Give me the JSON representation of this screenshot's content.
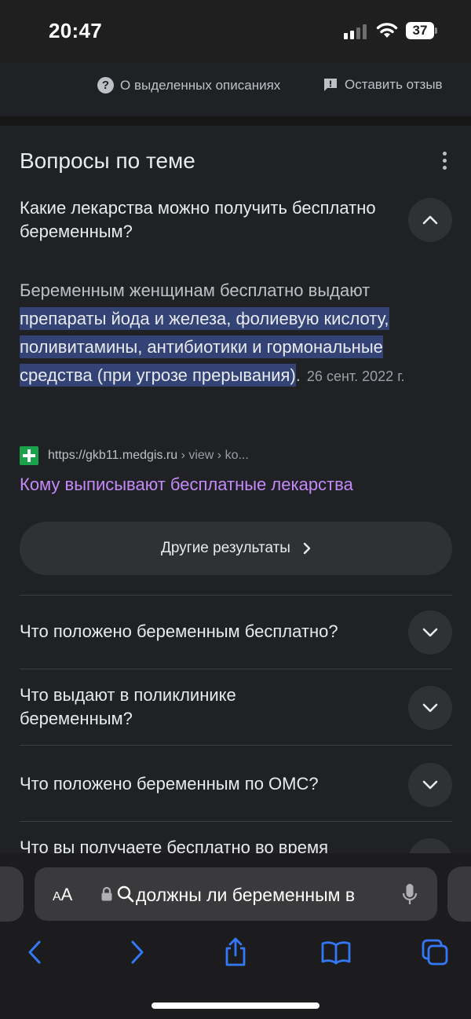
{
  "status_bar": {
    "time": "20:47",
    "battery": "37"
  },
  "top_links": {
    "about": "О выделенных описаниях",
    "feedback": "Оставить отзыв"
  },
  "section": {
    "title": "Вопросы по теме"
  },
  "expanded_question": {
    "question": "Какие лекарства можно получить бесплатно беременным?",
    "answer_prefix": "Беременным женщинам бесплатно выдают ",
    "answer_highlight": "препараты йода и железа, фолиевую кислоту, поливитамины, антибиотики и гормональные средства (при угрозе прерывания)",
    "answer_suffix": ".",
    "date": "26 сент. 2022 г.",
    "source_domain": "https://gkb11.medgis.ru",
    "source_path": " › view › ko...",
    "result_title": "Кому выписывают бесплатные лекарства",
    "more_results": "Другие результаты"
  },
  "questions": [
    {
      "text": "Что положено беременным бесплатно?"
    },
    {
      "text": "Что выдают в поликлинике беременным?"
    },
    {
      "text": "Что положено беременным по ОМС?"
    },
    {
      "text": "Что вы получаете бесплатно во время"
    }
  ],
  "address_bar": {
    "aa_small": "A",
    "aa_large": "A",
    "query": "должны ли беременным в"
  },
  "colors": {
    "background": "#202124",
    "highlight": "#334376",
    "link_visited": "#c58af9",
    "toolbar_accent": "#3478f6"
  }
}
